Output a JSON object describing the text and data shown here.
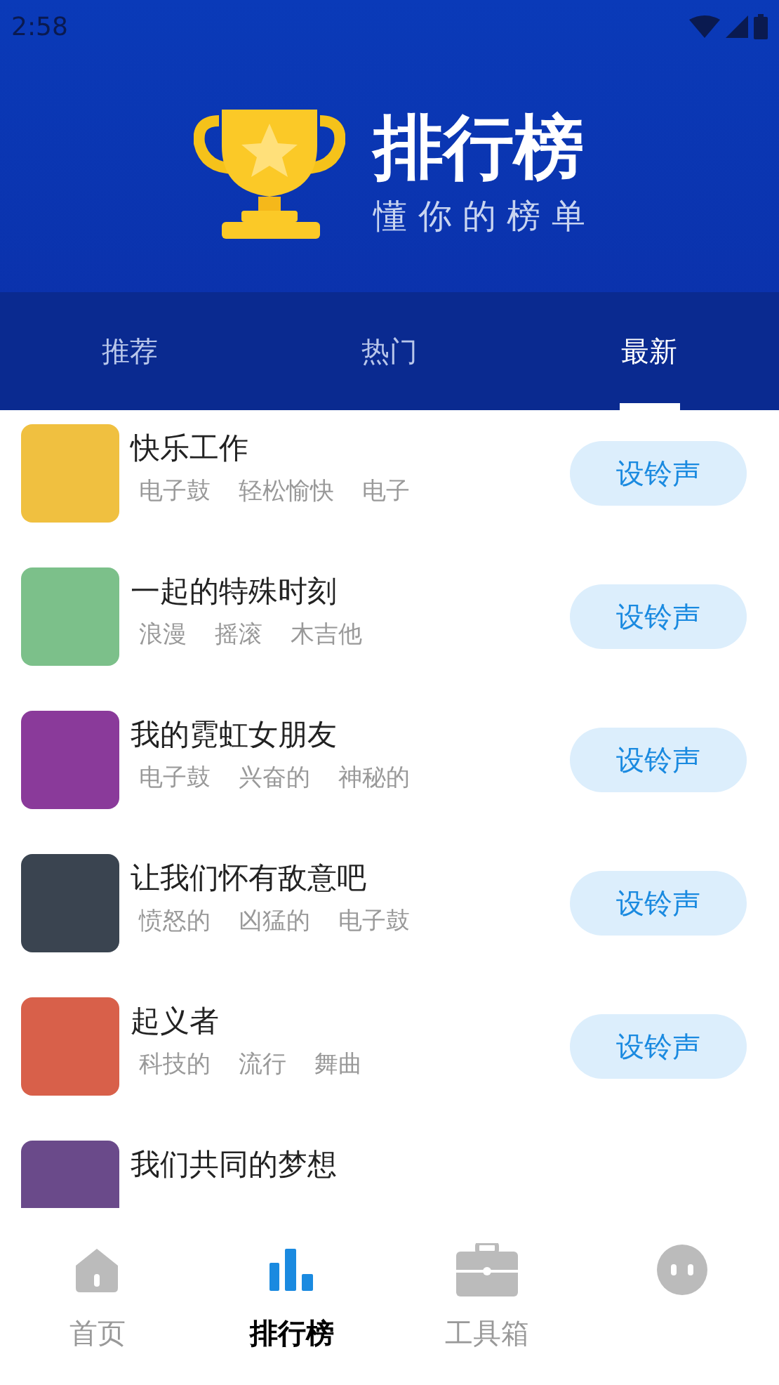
{
  "status_bar": {
    "time": "2:58"
  },
  "header": {
    "title": "排行榜",
    "subtitle": "懂 你 的 榜 单"
  },
  "tabs": [
    {
      "label": "推荐",
      "selected": false
    },
    {
      "label": "热门",
      "selected": false
    },
    {
      "label": "最新",
      "selected": true
    }
  ],
  "songs": [
    {
      "title": "快乐工作",
      "tags": [
        "电子鼓",
        "轻松愉快",
        "电子"
      ],
      "button": "设铃声",
      "color": "#f0c040"
    },
    {
      "title": "一起的特殊时刻",
      "tags": [
        "浪漫",
        "摇滚",
        "木吉他"
      ],
      "button": "设铃声",
      "color": "#7cc08a"
    },
    {
      "title": "我的霓虹女朋友",
      "tags": [
        "电子鼓",
        "兴奋的",
        "神秘的"
      ],
      "button": "设铃声",
      "color": "#8a3a9a"
    },
    {
      "title": "让我们怀有敌意吧",
      "tags": [
        "愤怒的",
        "凶猛的",
        "电子鼓"
      ],
      "button": "设铃声",
      "color": "#3a4450"
    },
    {
      "title": "起义者",
      "tags": [
        "科技的",
        "流行",
        "舞曲"
      ],
      "button": "设铃声",
      "color": "#d8604a"
    },
    {
      "title": "我们共同的梦想",
      "color": "#6a4a8a"
    }
  ],
  "nav": [
    {
      "label": "首页",
      "kind": "home",
      "selected": false
    },
    {
      "label": "排行榜",
      "kind": "chart",
      "selected": true
    },
    {
      "label": "工具箱",
      "kind": "toolbox",
      "selected": false
    },
    {
      "kind": "face",
      "selected": false
    }
  ]
}
